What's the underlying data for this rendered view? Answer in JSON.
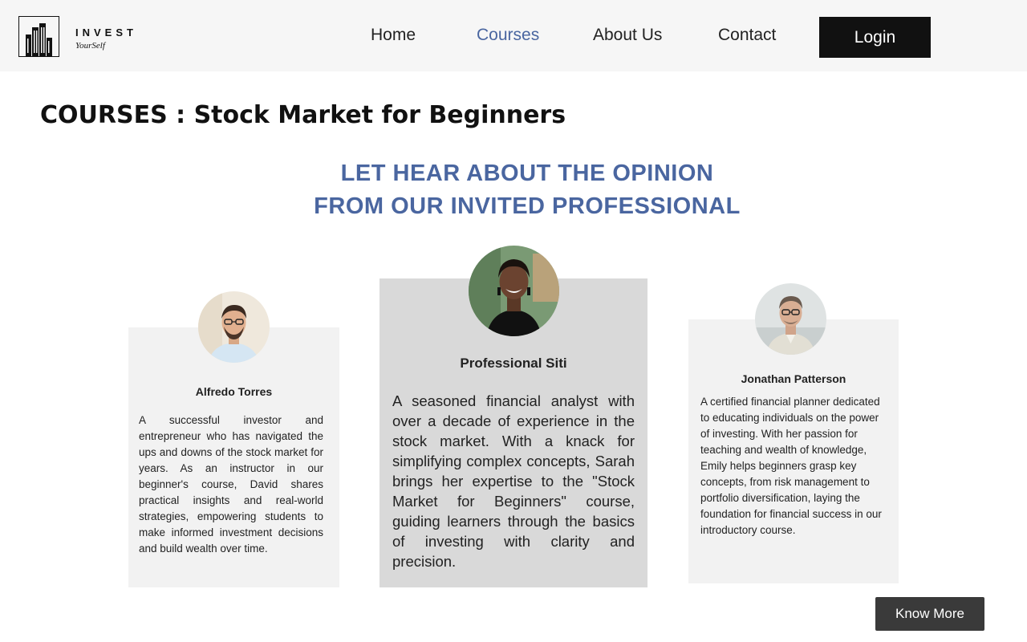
{
  "brand": {
    "name": "INVEST",
    "tagline": "YourSelf"
  },
  "nav": {
    "items": [
      {
        "label": "Home",
        "active": false
      },
      {
        "label": "Courses",
        "active": true
      },
      {
        "label": "About Us",
        "active": false
      },
      {
        "label": "Contact",
        "active": false
      }
    ],
    "login_label": "Login"
  },
  "page": {
    "title": "COURSES : Stock Market for Beginners",
    "subheading_line1": "LET HEAR ABOUT THE OPINION",
    "subheading_line2": "FROM OUR INVITED PROFESSIONAL"
  },
  "testimonials": [
    {
      "name": "Alfredo Torres",
      "text": "A successful investor and entrepreneur who has navigated the ups and downs of the stock market for years. As an instructor in our beginner's course, David shares practical insights and real-world strategies, empowering students to make informed investment decisions and build wealth over time."
    },
    {
      "name": "Professional Siti",
      "text": "A seasoned financial analyst with over a decade of experience in the stock market. With a knack for simplifying complex concepts, Sarah brings her expertise to the \"Stock Market for Beginners\" course, guiding learners through the basics of investing with clarity and precision."
    },
    {
      "name": "Jonathan Patterson",
      "text": "A certified financial planner dedicated to educating individuals on the power of investing. With her passion for teaching and wealth of knowledge, Emily helps beginners grasp key concepts, from risk management to portfolio diversification, laying the foundation for financial success in our introductory course."
    }
  ],
  "actions": {
    "know_more_label": "Know More"
  },
  "colors": {
    "accent": "#4a66a0",
    "header_bg": "#f6f6f6",
    "login_bg": "#111111",
    "card_light": "#f2f2f2",
    "card_featured": "#d9d9d9",
    "button_dark": "#3a3a3a"
  }
}
